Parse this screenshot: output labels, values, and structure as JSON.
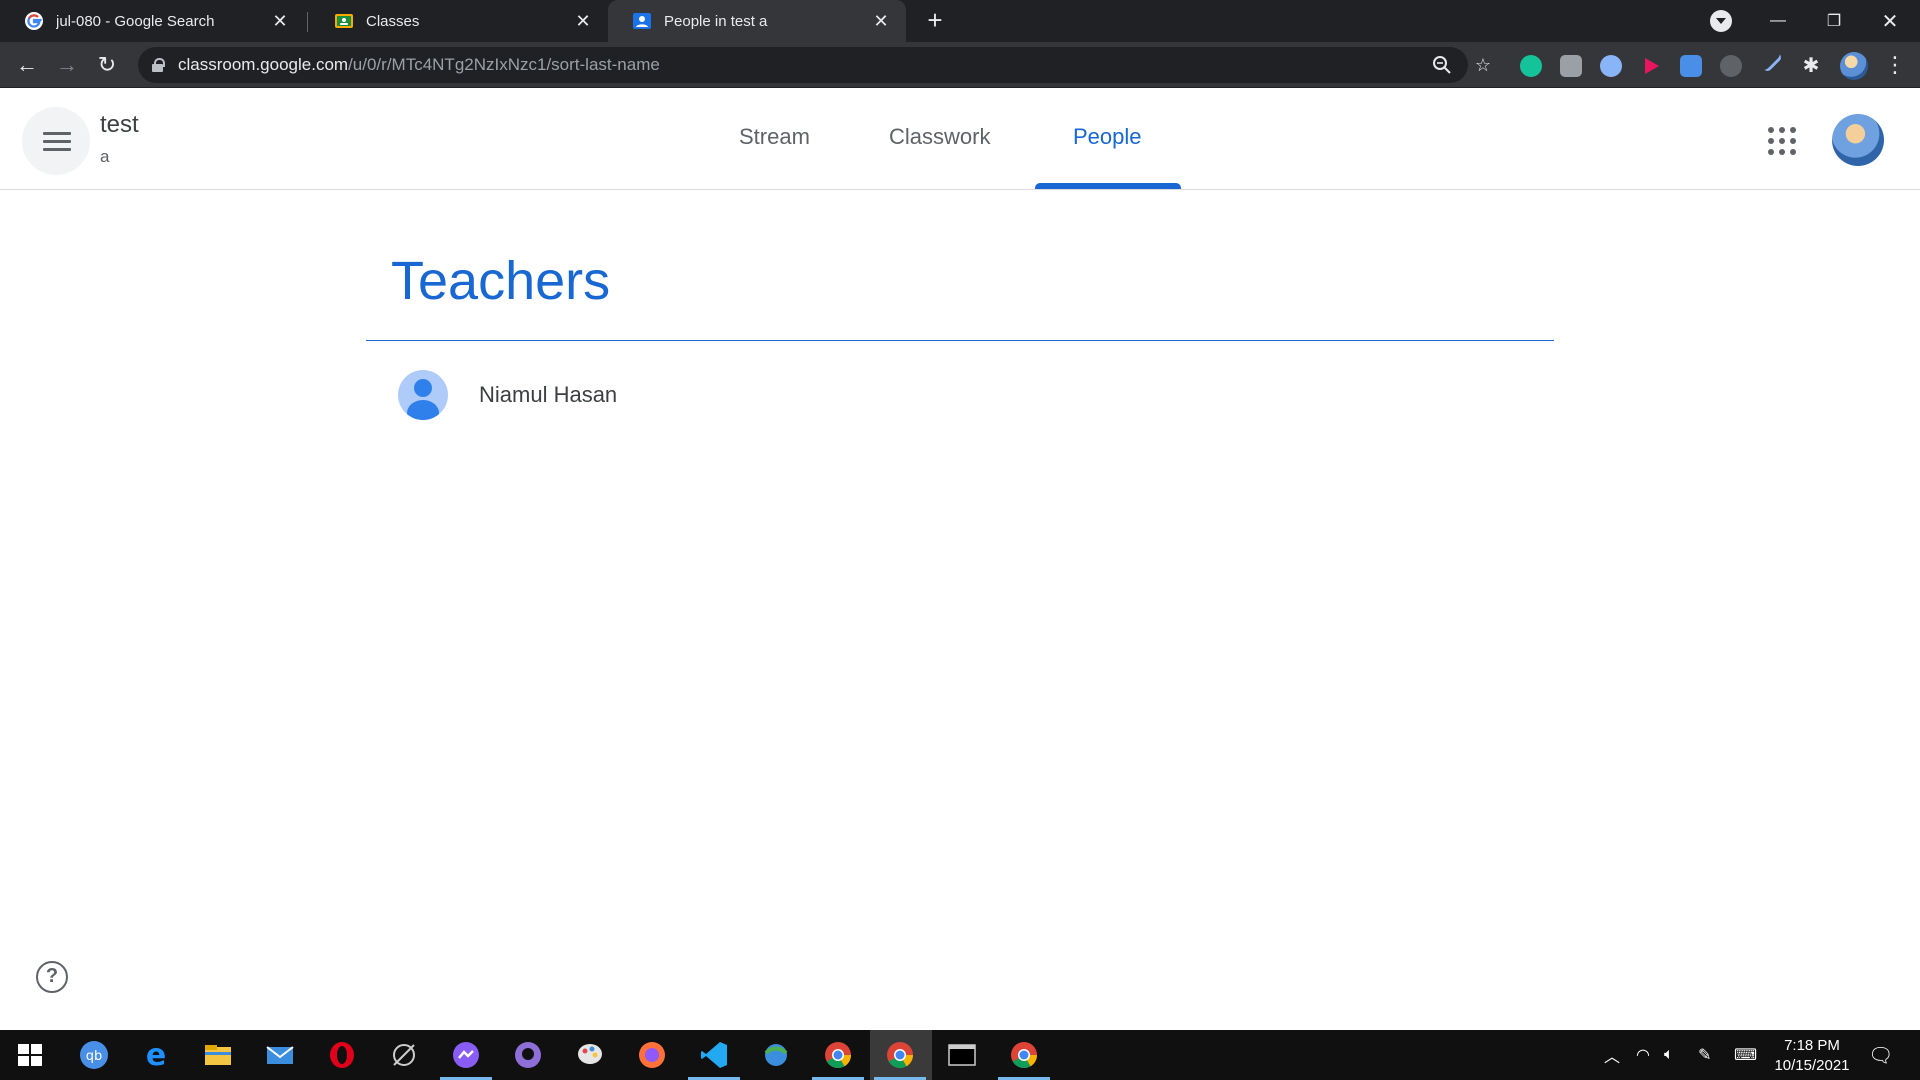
{
  "browser": {
    "tabs": [
      {
        "title": "jul-080 - Google Search",
        "favicon": "google-icon"
      },
      {
        "title": "Classes",
        "favicon": "classroom-icon"
      },
      {
        "title": "People in test a",
        "favicon": "people-icon",
        "active": true
      }
    ],
    "url_host": "classroom.google.com",
    "url_path": "/u/0/r/MTc4NTg2NzIxNzc1/sort-last-name"
  },
  "classroom": {
    "class_name": "test",
    "section": "a",
    "nav": [
      {
        "label": "Stream"
      },
      {
        "label": "Classwork"
      },
      {
        "label": "People",
        "active": true
      }
    ]
  },
  "people": {
    "teachers_heading": "Teachers",
    "teachers": [
      {
        "name": "Niamul Hasan"
      }
    ]
  },
  "help": {
    "icon": "help-icon",
    "glyph": "?"
  },
  "taskbar": {
    "time": "7:18 PM",
    "date": "10/15/2021"
  },
  "colors": {
    "accent": "#1967d2",
    "chrome_dark": "#202124",
    "toolbar": "#35363a"
  }
}
